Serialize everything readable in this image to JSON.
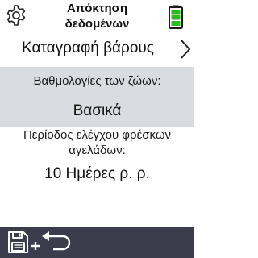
{
  "header": {
    "title_line1": "Απόκτηση",
    "title_line2": "δεδομένων",
    "settings_icon": "gear-icon",
    "battery_icon": "battery-full-icon",
    "battery_color": "#2db824"
  },
  "nav": {
    "label": "Καταγραφή βάρους",
    "arrow_icon": "chevron-right-icon"
  },
  "animal_scores": {
    "label": "Βαθμολογίες των ζώων:",
    "value": "Βασικά"
  },
  "fresh_cow_period": {
    "label_line1": "Περίοδος ελέγχου φρέσκων",
    "label_line2": "αγελάδων:",
    "value": "10 Ημέρες ρ. ρ."
  },
  "footer": {
    "save_return_icon": "save-and-return-icon",
    "background": "#3c3c4d"
  },
  "colors": {
    "shaded_section": "#d9dde1"
  }
}
